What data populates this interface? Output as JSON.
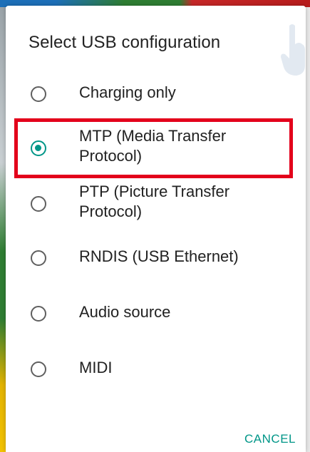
{
  "dialog": {
    "title": "Select USB configuration",
    "options": [
      {
        "label": "Charging only",
        "selected": false
      },
      {
        "label": "MTP (Media Transfer Protocol)",
        "selected": true
      },
      {
        "label": "PTP (Picture Transfer Protocol)",
        "selected": false
      },
      {
        "label": "RNDIS (USB Ethernet)",
        "selected": false
      },
      {
        "label": "Audio source",
        "selected": false
      },
      {
        "label": "MIDI",
        "selected": false
      }
    ],
    "cancel_label": "CANCEL"
  },
  "colors": {
    "accent": "#009688",
    "highlight_border": "#e3001b",
    "radio_unselected": "#5f5f5f",
    "text": "#212121"
  },
  "icons": {
    "watermark": "pointing-hand-icon"
  }
}
